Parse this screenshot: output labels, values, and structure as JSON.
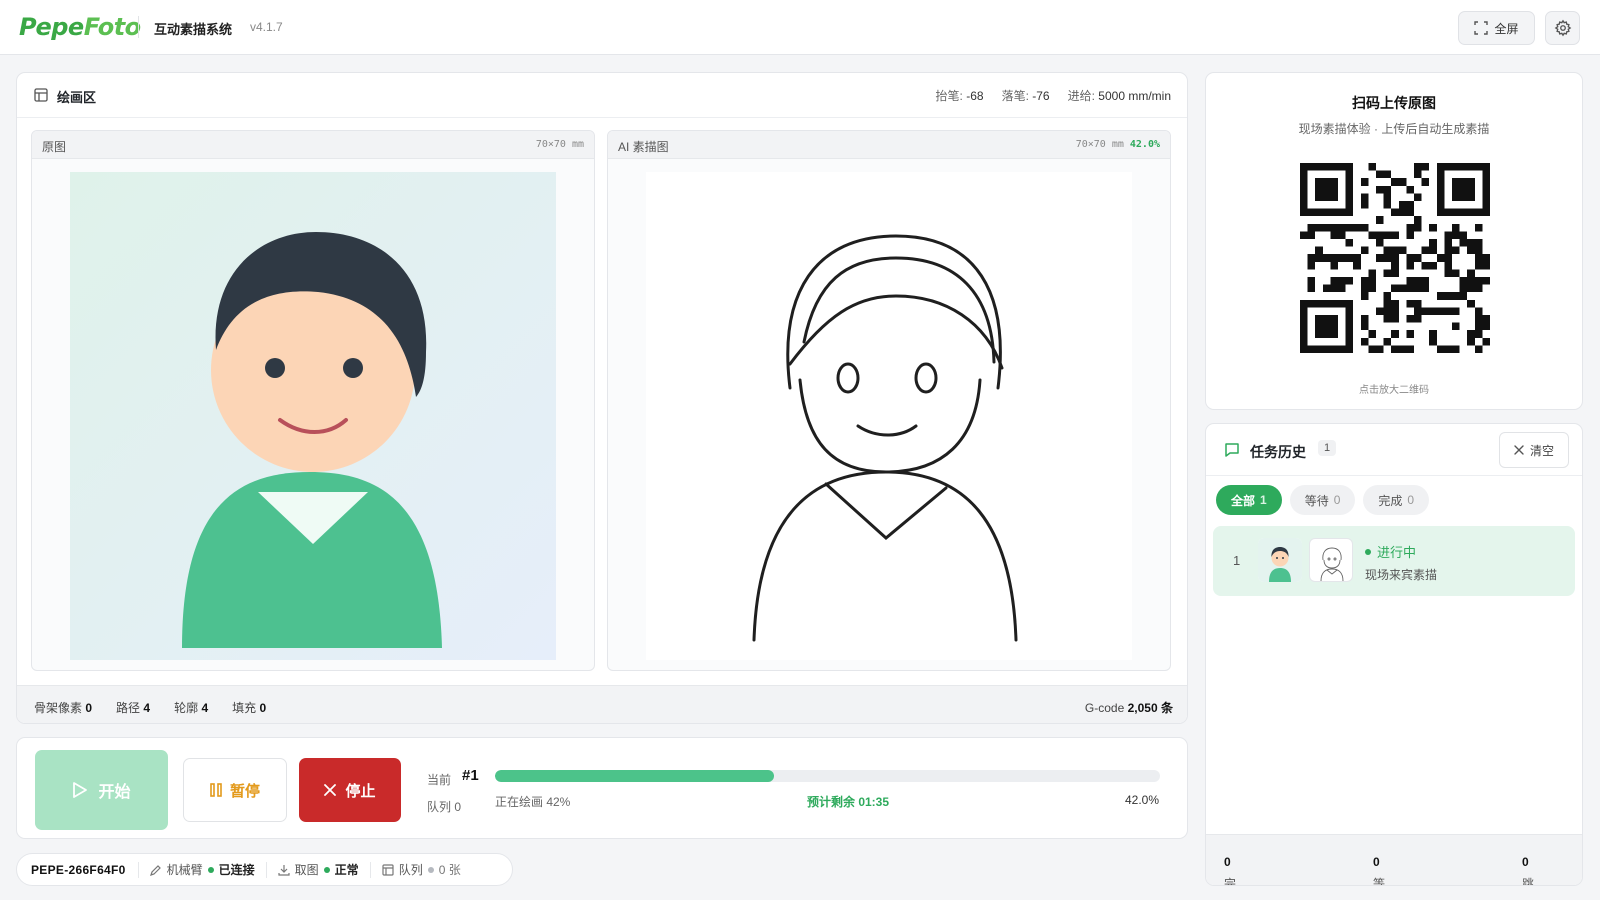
{
  "app": {
    "logo_part1": "Pepe",
    "logo_part2": "Foto",
    "title": "互动素描系统",
    "version": "v4.1.7",
    "fullscreen_label": "全屏"
  },
  "canvas": {
    "title": "绘画区",
    "stats": [
      {
        "label": "抬笔:",
        "value": "-68"
      },
      {
        "label": "落笔:",
        "value": "-76"
      },
      {
        "label": "进给:",
        "value": "5000 mm/min"
      }
    ],
    "original": {
      "label": "原图",
      "size": "70×70 mm"
    },
    "sketch": {
      "label": "AI 素描图",
      "size": "70×70 mm",
      "percent": "42.0%"
    },
    "footer": [
      {
        "label": "骨架像素",
        "value": "0"
      },
      {
        "label": "路径",
        "value": "4"
      },
      {
        "label": "轮廓",
        "value": "4"
      },
      {
        "label": "填充",
        "value": "0"
      }
    ],
    "gcode": {
      "label": "G-code",
      "value": "2,050 条"
    }
  },
  "controls": {
    "start_label": "开始",
    "pause_label": "暂停",
    "stop_label": "停止",
    "current_label": "当前",
    "current_value": "#1",
    "queue_text": "队列 0",
    "progress_fraction": 0.42,
    "status_text": "正在绘画 42%",
    "eta_text": "预计剩余 01:35",
    "percent_text": "42.0%"
  },
  "statusbar": {
    "device_id": "PEPE-266F64F0",
    "items": [
      {
        "icon": "pencil-icon",
        "label": "机械臂",
        "dot_color": "#2eaa5c",
        "value": "已连接"
      },
      {
        "icon": "download-icon",
        "label": "取图",
        "dot_color": "#2eaa5c",
        "value": "正常"
      },
      {
        "icon": "layout-icon",
        "label": "队列",
        "dot_color": "#b5b9bf",
        "value": "0 张"
      }
    ]
  },
  "qr": {
    "title": "扫码上传原图",
    "subtitle": "现场素描体验 · 上传后自动生成素描",
    "hint": "点击放大二维码"
  },
  "history": {
    "title": "任务历史",
    "count": "1",
    "clear_label": "清空",
    "tabs": [
      {
        "label": "全部",
        "count": "1",
        "active": true
      },
      {
        "label": "等待",
        "count": "0",
        "active": false
      },
      {
        "label": "完成",
        "count": "0",
        "active": false
      }
    ],
    "tasks": [
      {
        "index": "1",
        "status": "进行中",
        "description": "现场来宾素描"
      }
    ],
    "footer": [
      {
        "label": "完成",
        "value": "0"
      },
      {
        "label": "等待",
        "value": "0"
      },
      {
        "label": "跳过",
        "value": "0"
      }
    ]
  },
  "colors": {
    "accent_green": "#2eaa5c",
    "progress_green": "#4cc38a",
    "stop_red": "#c92a2a",
    "pause_orange": "#e39a1c",
    "start_disabled": "#a9e3c4"
  }
}
